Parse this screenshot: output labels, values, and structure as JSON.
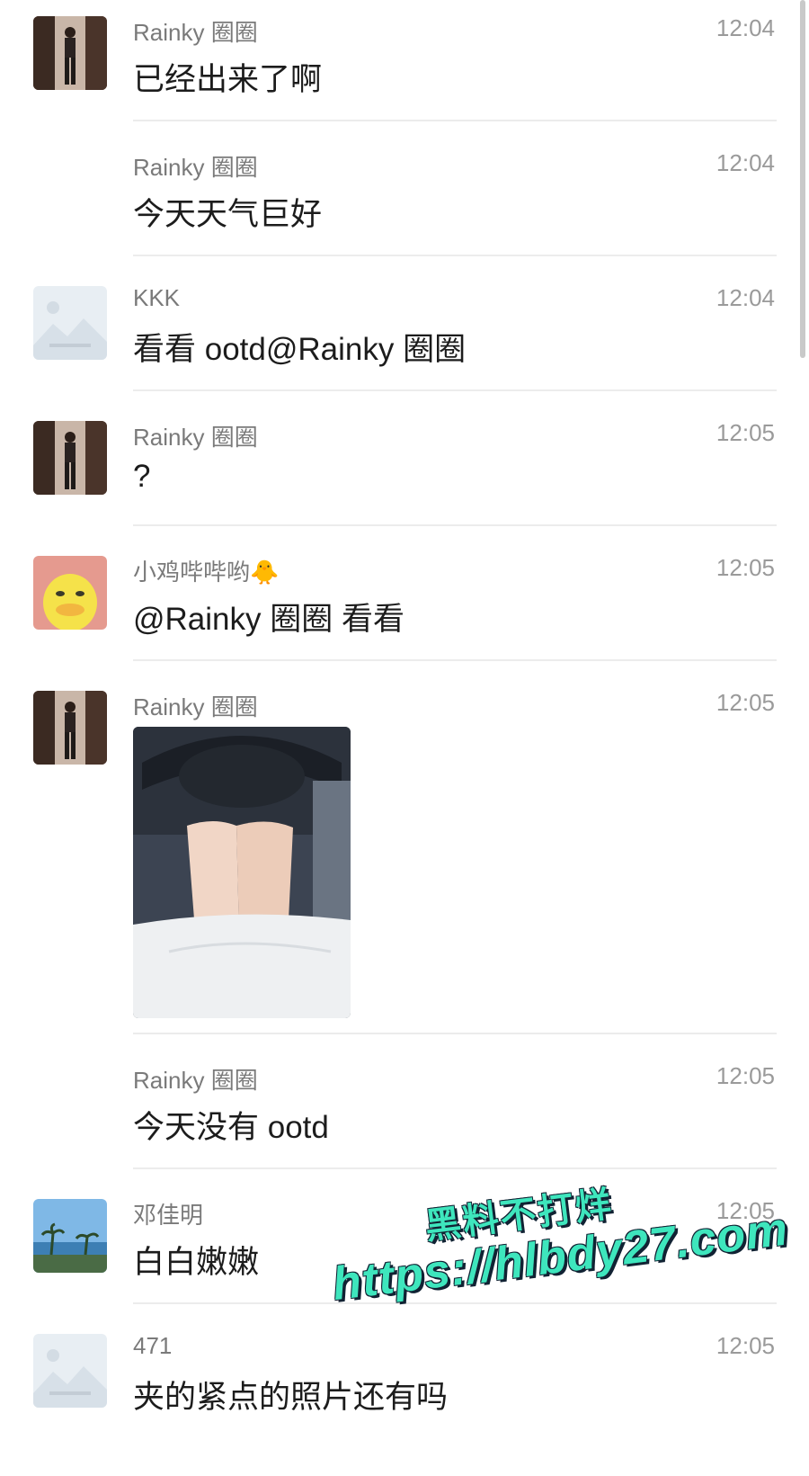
{
  "messages": [
    {
      "sender": "Rainky 圈圈",
      "time": "12:04",
      "text": "已经出来了啊",
      "avatar": "photo-woman"
    },
    {
      "sender": "Rainky 圈圈",
      "time": "12:04",
      "text": "今天天气巨好",
      "avatar": ""
    },
    {
      "sender": "KKK",
      "time": "12:04",
      "text": "看看 ootd@Rainky 圈圈",
      "avatar": "placeholder-landscape"
    },
    {
      "sender": "Rainky 圈圈",
      "time": "12:05",
      "text": "?",
      "avatar": "photo-woman"
    },
    {
      "sender": "小鸡哔哔哟🐥",
      "time": "12:05",
      "text": "@Rainky 圈圈 看看",
      "avatar": "yellow-duck"
    },
    {
      "sender": "Rainky 圈圈",
      "time": "12:05",
      "text": "",
      "avatar": "photo-woman",
      "image": "car-interior-photo"
    },
    {
      "sender": "Rainky 圈圈",
      "time": "12:05",
      "text": "今天没有 ootd",
      "avatar": ""
    },
    {
      "sender": "邓佳明",
      "time": "12:05",
      "text": "白白嫩嫩",
      "avatar": "beach-palm-trees"
    },
    {
      "sender": "471",
      "time": "12:05",
      "text": "夹的紧点的照片还有吗",
      "avatar": "placeholder-landscape"
    }
  ],
  "watermark": {
    "line1": "黑料不打烊",
    "line2": "https://hlbdy27.com",
    "color": "#3ee6bd"
  },
  "colors": {
    "name": "#7a7a7a",
    "time": "#9a9a9a",
    "text": "#1c1c1c",
    "divider": "#ececec"
  }
}
